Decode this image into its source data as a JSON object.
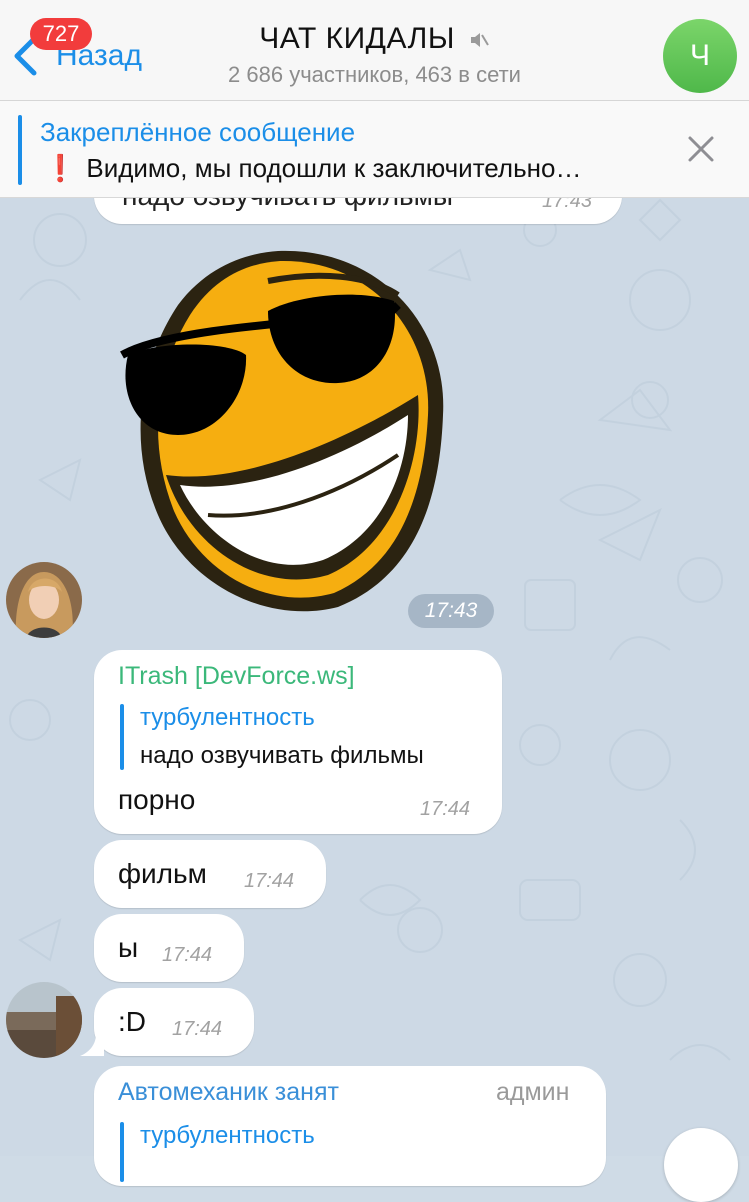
{
  "header": {
    "back_label": "Назад",
    "unread_badge": "727",
    "title": "ЧАТ КИДАЛЫ",
    "subtitle": "2 686 участников, 463 в сети",
    "avatar_letter": "Ч",
    "muted_icon": "speaker-muted-icon"
  },
  "pinned": {
    "title": "Закреплённое сообщение",
    "exclamation": "❗",
    "text": "Видимо, мы подошли к заключительно…"
  },
  "partial_message": {
    "text": "надо озвучивать фильмы",
    "time": "17:43"
  },
  "sticker": {
    "name": "sunglasses-laughing-face-sticker",
    "time": "17:43"
  },
  "messages": [
    {
      "sender": "ITrash [DevForce.ws]",
      "sender_color": "#3bb87a",
      "reply_author": "турбулентность",
      "reply_text": "надо озвучивать фильмы",
      "text": "порно",
      "time": "17:44"
    },
    {
      "text": "фильм",
      "time": "17:44"
    },
    {
      "text": "ы",
      "time": "17:44"
    },
    {
      "text": ":D",
      "time": "17:44"
    },
    {
      "sender": "Автомеханик занят",
      "sender_color": "#3a8fd8",
      "role": "админ",
      "reply_author": "турбулентность"
    }
  ],
  "colors": {
    "accent": "#1b8ee8",
    "badge": "#f23c3c",
    "chat_background": "#cdd9e5"
  }
}
